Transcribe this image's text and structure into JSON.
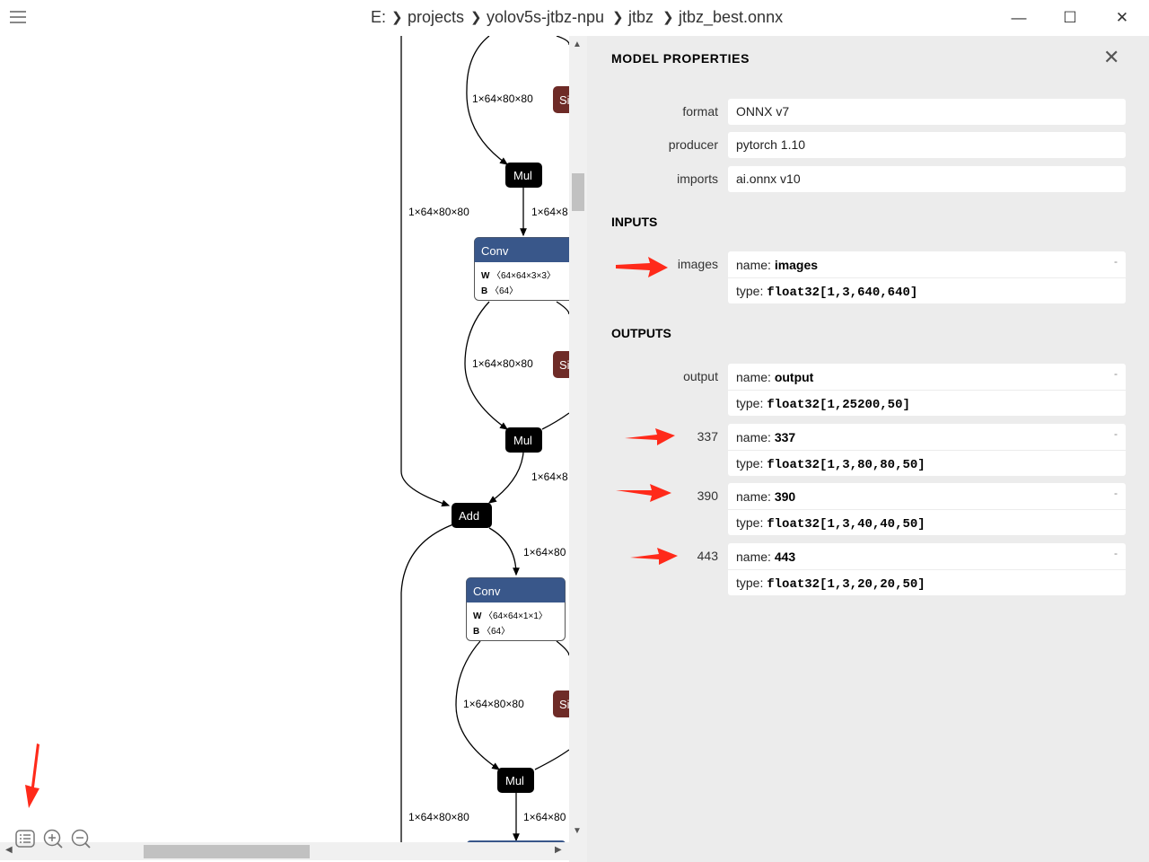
{
  "breadcrumb": [
    "E:",
    "projects",
    "yolov5s-jtbz-npu",
    "jtbz",
    "jtbz_best.onnx"
  ],
  "window": {
    "minimize": "—",
    "maximize": "☐",
    "close": "✕"
  },
  "graph": {
    "edge_labels": {
      "a": "1×64×80×80",
      "b": "1×64×80×80",
      "c": "1×64×8",
      "d": "1×64×80×80",
      "e": "1×64×8",
      "f": "1×64×80",
      "g": "1×64×80×80",
      "h": "1×64×80×80",
      "i": "1×64×80"
    },
    "nodes": {
      "mul1": "Mul",
      "mul2": "Mul",
      "mul3": "Mul",
      "add": "Add",
      "conv1": "Conv",
      "conv2": "Conv",
      "sig": "Si"
    },
    "conv1_attrs": {
      "w_key": "W",
      "w_val": "〈64×64×3×3〉",
      "b_key": "B",
      "b_val": "〈64〉"
    },
    "conv2_attrs": {
      "w_key": "W",
      "w_val": "〈64×64×1×1〉",
      "b_key": "B",
      "b_val": "〈64〉"
    }
  },
  "panel": {
    "title": "MODEL PROPERTIES",
    "close": "✕",
    "props": [
      {
        "label": "format",
        "value": "ONNX v7"
      },
      {
        "label": "producer",
        "value": "pytorch 1.10"
      },
      {
        "label": "imports",
        "value": "ai.onnx v10"
      }
    ],
    "inputs_header": "INPUTS",
    "inputs": [
      {
        "label": "images",
        "name_key": "name:",
        "name": "images",
        "type_key": "type:",
        "type": "float32[1,3,640,640]"
      }
    ],
    "outputs_header": "OUTPUTS",
    "outputs": [
      {
        "label": "output",
        "name_key": "name:",
        "name": "output",
        "type_key": "type:",
        "type": "float32[1,25200,50]"
      },
      {
        "label": "337",
        "name_key": "name:",
        "name": "337",
        "type_key": "type:",
        "type": "float32[1,3,80,80,50]"
      },
      {
        "label": "390",
        "name_key": "name:",
        "name": "390",
        "type_key": "type:",
        "type": "float32[1,3,40,40,50]"
      },
      {
        "label": "443",
        "name_key": "name:",
        "name": "443",
        "type_key": "type:",
        "type": "float32[1,3,20,20,50]"
      }
    ],
    "expand_glyph": "-"
  },
  "colors": {
    "conv_header": "#39578a",
    "sigmoid": "#6e2b27",
    "panel_bg": "#ececec",
    "arrow": "#ff2a1a"
  },
  "toolbar": {
    "icons": [
      "list-icon",
      "zoom-in-icon",
      "zoom-out-icon"
    ]
  }
}
